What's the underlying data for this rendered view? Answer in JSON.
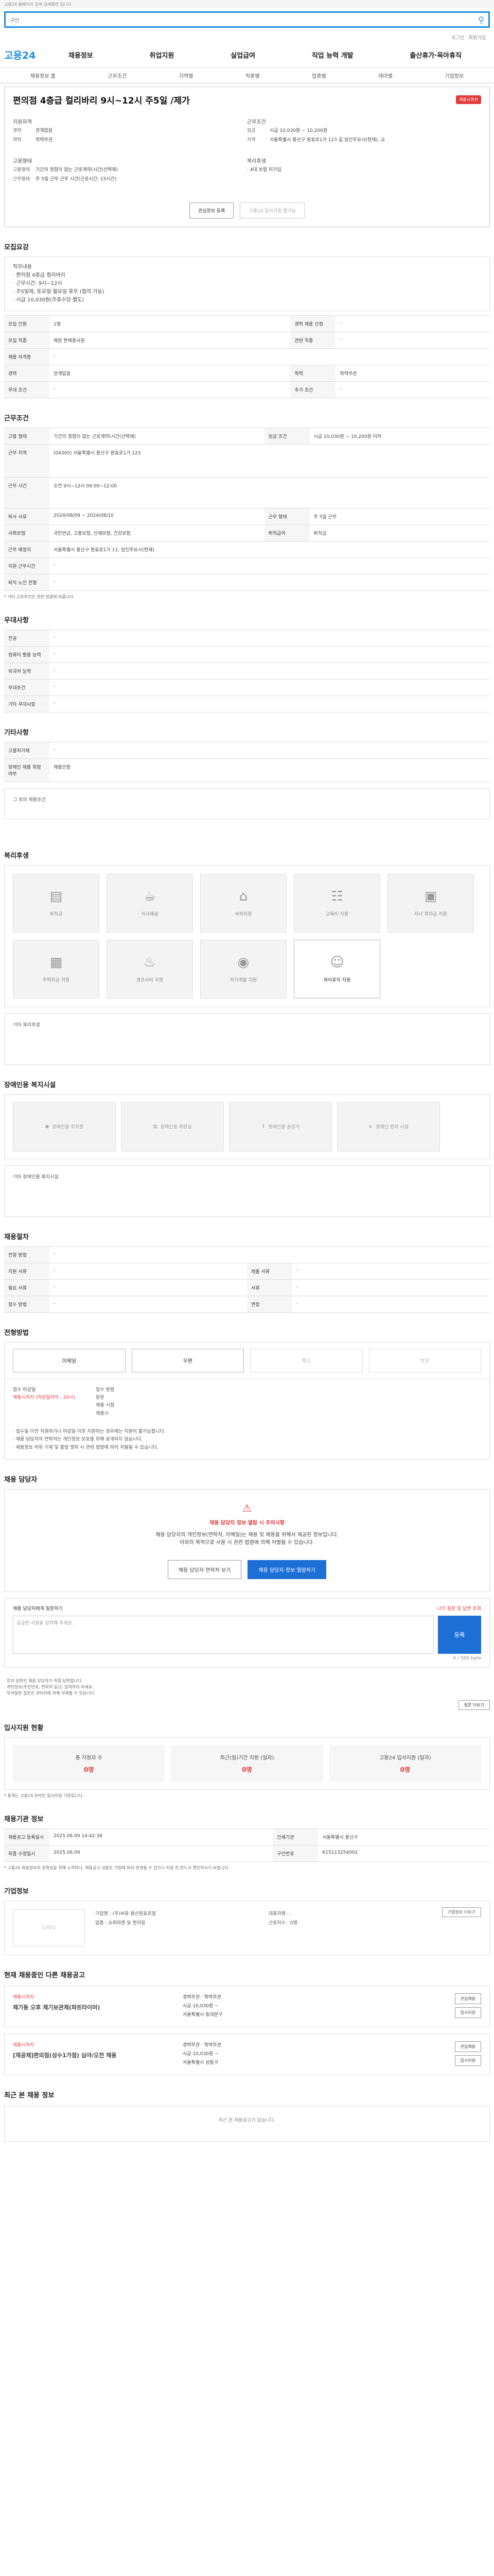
{
  "topbar": "고용24 홈페이지 검색 상세화면 입니다.",
  "search": {
    "value": "구인"
  },
  "subtop": "로그인 · 회원가입",
  "logo": "고용24",
  "gnb": [
    "채용정보",
    "취업지원",
    "실업급여",
    "직업 능력 개발",
    "출산휴가·육아휴직"
  ],
  "lnb": [
    "채용정보 홈",
    "근무조건",
    "지역별",
    "직종별",
    "업종별",
    "테마별",
    "기업정보"
  ],
  "title": "편의점 4층급 컬리바리 9시~12시 주5일 /제가",
  "badge": "채용시까지",
  "recruit": {
    "head": "지원자격",
    "k1": "경력",
    "v1": "관계없음",
    "k2": "학력",
    "v2": "학력무관"
  },
  "work": {
    "head": "근무조건",
    "k1": "임금",
    "v1": "시급 10,030원 ~ 10,200원",
    "k2": "지역",
    "v2": "서울특별시 용산구 원효로1가 123 길 임인주요시(현재), 교"
  },
  "emp": {
    "head": "고용형태",
    "k1": "고용형태",
    "v1": "기간의 정함이 없는 근로계약(시간(선택제)",
    "k2": "근무형태",
    "v2": "주 5일 근무 근무 시간(근로시간: 15시간)"
  },
  "welfare": {
    "head": "복리후생",
    "v": "· 4대 보험 미가입"
  },
  "btn_save": "관심정보 등록",
  "btn_apply": "고용24 입사지원 불가능",
  "sec_recruit": "모집요강",
  "job_content": [
    "직무내용",
    "· 편의점 4층급 컬리바리",
    "· 근무시간: 9시~12시",
    "· 주5일제, 토요일·월요일 휴무 (협의 가능)",
    "· 시급 10,030원(주휴수당 별도)"
  ],
  "recruit_rows": [
    [
      "모집 인원",
      "1명",
      "경력 채용 선정",
      "-"
    ],
    [
      "모집 직종",
      "매장 판매종사원",
      "관련 직종",
      "-"
    ],
    [
      "채용 자격증",
      "-",
      "",
      ""
    ],
    [
      "경력",
      "관계없음",
      "학력",
      "학력무관"
    ],
    [
      "우대 조건",
      "-",
      "추가 조건",
      "-"
    ]
  ],
  "sec_work": "근무조건",
  "work_rows": [
    [
      "고용 형태",
      "기간의 정함이 없는 근로계약(시간(선택제)",
      "임금 조건",
      "시급 10,030원 ~ 10,200원 이하"
    ],
    [
      "근무 지역",
      "(04365) 서울특별시 용산구 원효로1가 123",
      "",
      ""
    ],
    [
      "근무 시간",
      "오전 9시~12시 09:00~12:00",
      "",
      ""
    ],
    [
      "퇴사 사유",
      "2024/08/09 ~ 2024/08/10",
      "근무 형태",
      "주 5일 근무"
    ],
    [
      "사회보험",
      "국민연금, 고용보험, 산재보험, 건강보험",
      "퇴직급여",
      "퇴직금"
    ],
    [
      "근무 예정지",
      "서울특별시 용산구 원효로1가 11, 임인주요시(현재)",
      "",
      ""
    ],
    [
      "지원 근무시간",
      "-",
      "",
      ""
    ],
    [
      "퇴직 노인 전형",
      "-",
      "",
      ""
    ]
  ],
  "work_note": "* 기타 근로조건은 관련 법령에 따릅니다.",
  "sec_pref": "우대사항",
  "pref_rows": [
    [
      "전공",
      "-"
    ],
    [
      "컴퓨터 활용 능력",
      "-"
    ],
    [
      "외국어 능력",
      "-"
    ],
    [
      "우대조건",
      "-"
    ],
    [
      "기타 우대사항",
      "-"
    ]
  ],
  "sec_etc": "기타사항",
  "etc_rows": [
    [
      "고용허가제",
      "-"
    ],
    [
      "장애인 채용 희망 여부",
      "채용안함"
    ]
  ],
  "etc_extra": "그 외의 채용조건",
  "sec_benefit": "복리후생",
  "benefits": [
    "퇴직금",
    "식사제공",
    "숙박지원",
    "교육비 지원",
    "자녀 학자금 지원",
    "주택자금 지원",
    "경조사비 지원",
    "자기계발 지원",
    "육아휴직 지원"
  ],
  "benefit_icons": [
    "bus-icon",
    "meal-icon",
    "house-icon",
    "book-icon",
    "gift-icon",
    "calendar-icon",
    "cake-icon",
    "money-icon",
    "baby-icon"
  ],
  "other_benefit": "기타 복리후생",
  "sec_facility": "장애인용 복지시설",
  "facilities": [
    "장애인용 주차장",
    "장애인용 화장실",
    "장애인용 승강기",
    "장애인 편의 시설"
  ],
  "other_facility": "기타 장애인용 복지시설",
  "sec_process": "채용절차",
  "process_rows": [
    [
      "전형 방법",
      "-"
    ],
    [
      "지원 서류",
      "-",
      "제출 서류",
      "-"
    ],
    [
      "필요 서류",
      "-",
      "서류",
      "-"
    ],
    [
      "접수 방법",
      "-",
      "면접",
      "-"
    ]
  ],
  "sec_apply": "전형방법",
  "apply_btns": [
    "이메일",
    "우편",
    "팩스",
    "방문"
  ],
  "apply_info": {
    "k1": "접수 마감일",
    "v1": "채용시까지 (마감일까지 : 20시)",
    "k2": "접수 방법",
    "v2": "방문",
    "k3": "채용 시점",
    "v3": "채용시"
  },
  "apply_notes": [
    "· 접수일 이전 지원하거나 마감일 이후 지원하는 경우에는 지원이 불가능합니다.",
    "· 채용 담당자의 연락처는 개인정보 보호를 위해 공개되지 않습니다.",
    "· 채용정보 허위 기재 및 불법 행위 시 관련 법령에 따라 처벌될 수 있습니다."
  ],
  "sec_contact": "채용 담당자",
  "contact_title": "채용 담당자 정보 열람 시 주의사항",
  "contact_desc": [
    "채용 담당자의 개인정보(연락처, 이메일)는 채용 및 채용을 위해서 제공된 정보입니다.",
    "이외의 목적으로 사용 시 관련 법령에 의해 처벌될 수 있습니다."
  ],
  "contact_btns": [
    "채용 담당자 연락처 보기",
    "채용 담당자 정보 열람하기"
  ],
  "ask_head": "채용 담당자에게 질문하기",
  "ask_link": "나의 질문 및 답변 조회",
  "ask_placeholder": "궁금한 사항을 입력해 주세요.",
  "ask_send": "등록",
  "ask_count": "0 / 500 byte",
  "ask_notes": [
    "· 문의 답변은 채용 담당자가 직접 답변합니다.",
    "· 개인정보(주민번호, 연락처 등)는 입력하지 마세요.",
    "· 부적절한 질문은 관리자에 의해 삭제될 수 있습니다."
  ],
  "ask_more": "질문 더보기",
  "sec_stats": "입사지원 현황",
  "stats": [
    [
      "총 지원자 수",
      "0명"
    ],
    [
      "최근(일)기간 지원 (일자)",
      "0명"
    ],
    [
      "고용24 입사지원 (일자)",
      "0명"
    ]
  ],
  "stats_note": "* 통계는 고용24 온라인 입사지원 기준입니다.",
  "sec_info": "채용기관 정보",
  "info_rows": [
    [
      "채용공고 등록일시",
      "2025.06.09 14:42:38",
      "인쇄기관",
      "서울특별시 용산구"
    ],
    [
      "최종 수정일시",
      "2025.06.09",
      "구인번호",
      "K15113254002"
    ]
  ],
  "info_note": "* 고용24 채용정보의 정확성을 위해 노력하나, 채용공고 내용은 기업에 따라 변경될 수 있으니 지원 전 반드시 확인하시기 바랍니다.",
  "sec_corp": "기업정보",
  "corp": {
    "logo": "LOGO",
    "k1": "기업명",
    "v1": "(주)씨유 용산원효로점",
    "k2": "업종",
    "v2": "슈퍼마켓 및 편의점",
    "k3": "대표자명",
    "v3": "-",
    "k4": "근로자수",
    "v4": "0명",
    "btn": "기업정보 더보기"
  },
  "sec_similar": "현재 채용중인 다른 채용공고",
  "similar": [
    {
      "tag": "채용시까지",
      "name": "제기동 오후 제기보관제(파트타이머)",
      "k1": "경력무관",
      "k2": "학력무관",
      "k3": "시급 10,030원 ~",
      "k4": "서울특별시 동대문구",
      "btn1": "관심채용",
      "btn2": "입사지원"
    },
    {
      "tag": "채용시까지",
      "name": "[재공채]편의점(성수1가점) 심야/오전 채용",
      "k1": "경력무관",
      "k2": "학력무관",
      "k3": "시급 10,030원 ~",
      "k4": "서울특별시 성동구",
      "btn1": "관심채용",
      "btn2": "입사지원"
    }
  ],
  "sec_recent": "최근 본 채용 정보",
  "recent_empty": "최근 본 채용공고가 없습니다."
}
